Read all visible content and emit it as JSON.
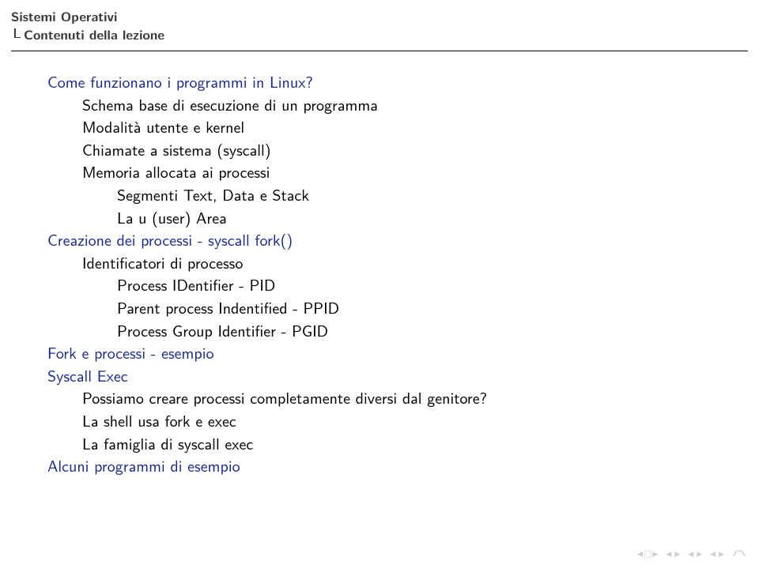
{
  "header": {
    "line1": "Sistemi Operativi",
    "line2": "Contenuti della lezione"
  },
  "outline": {
    "s1": "Come funzionano i programmi in Linux?",
    "s1_1": "Schema base di esecuzione di un programma",
    "s1_2": "Modalità utente e kernel",
    "s1_3": "Chiamate a sistema (syscall)",
    "s1_4": "Memoria allocata ai processi",
    "s1_4_1": "Segmenti Text, Data e Stack",
    "s1_4_2": "La u (user) Area",
    "s2": "Creazione dei processi - syscall fork()",
    "s2_1": "Identificatori di processo",
    "s2_1_1": "Process IDentifier - PID",
    "s2_1_2": "Parent process Indentified - PPID",
    "s2_1_3": "Process Group Identifier - PGID",
    "s3": "Fork e processi - esempio",
    "s4": "Syscall Exec",
    "s4_1": "Possiamo creare processi completamente diversi dal genitore?",
    "s4_2": "La shell usa fork e exec",
    "s4_3": "La famiglia di syscall exec",
    "s5": "Alcuni programmi di esempio"
  }
}
